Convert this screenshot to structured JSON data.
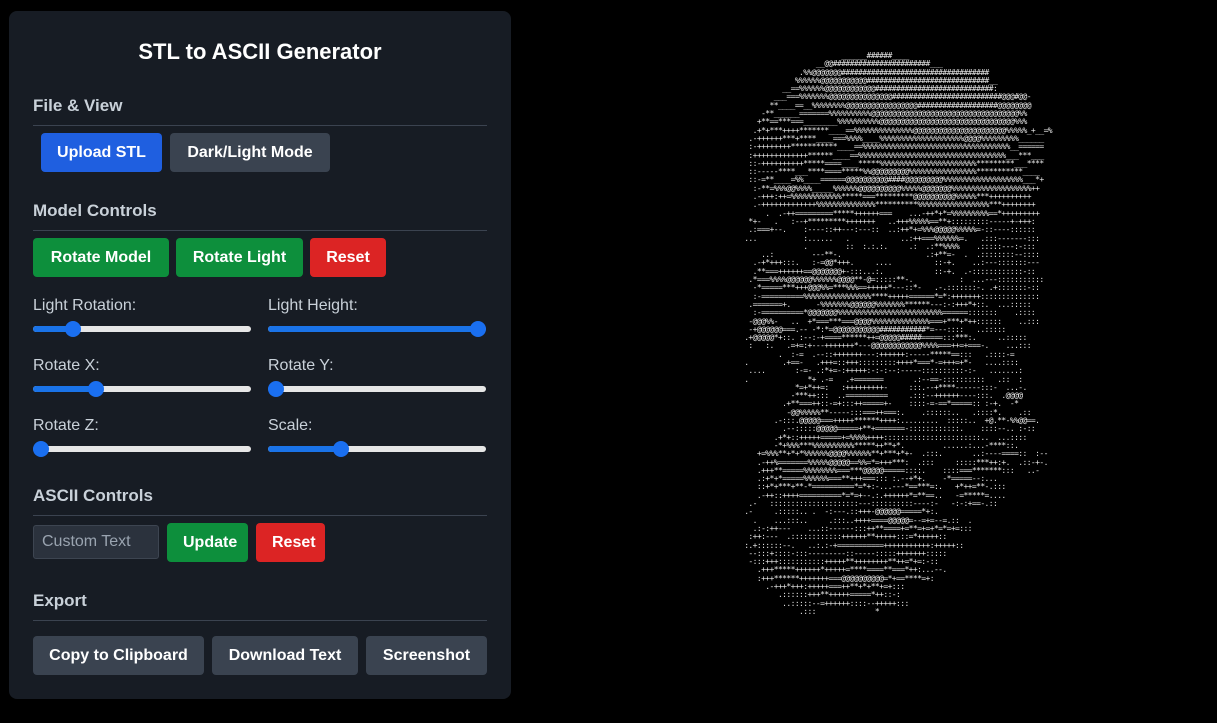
{
  "title": "STL to ASCII Generator",
  "sections": {
    "file_view": "File & View",
    "model_controls": "Model Controls",
    "ascii_controls": "ASCII Controls",
    "export": "Export"
  },
  "buttons": {
    "upload": "Upload STL",
    "theme": "Dark/Light Mode",
    "rotate_model": "Rotate Model",
    "rotate_light": "Rotate Light",
    "reset_model": "Reset",
    "update": "Update",
    "reset_ascii": "Reset",
    "copy": "Copy to Clipboard",
    "download": "Download Text",
    "screenshot": "Screenshot"
  },
  "sliders": [
    {
      "label": "Light Rotation:",
      "value": 0.16
    },
    {
      "label": "Light Height:",
      "value": 1.0
    },
    {
      "label": "Rotate X:",
      "value": 0.27
    },
    {
      "label": "Rotate Y:",
      "value": 0.0
    },
    {
      "label": "Rotate Z:",
      "value": 0.0
    },
    {
      "label": "Scale:",
      "value": 0.32
    }
  ],
  "custom_text": {
    "placeholder": "Custom Text",
    "value": ""
  },
  "colors": {
    "background": "#000000",
    "panel": "#171c24",
    "blue": "#1f5fe0",
    "green": "#0d8f3c",
    "red": "#dc2424",
    "gray": "#3a4350",
    "slider_accent": "#1a73e8"
  },
  "ascii_art": "                        ______######____\n                  __@@#######################___\n              .%%@@@@@@@###################################\n             %%%%%%@@@@@@@@@@@#############################__\n          __==%%%%%%@@@@@@@@@@@@############################:\n        ___===%%%%%%%@@@@@@@@@@@@@@@##########################@@@#@@-\n       **____==__%%%%%%%%@@@@@@@@@@@@@@@@@###################@@@@@@@@\n     -**______=======%%%%%%%%%%@@@@@@@@@@@@@@@@@@@@@@@@@@@@@@@@@@@%%\n    +**==***===________%%%%%%%%%%@@@@@@@@@@@@@@@@@@@@@@@@@@@@@@@@%%%\n   .+*+***++++*******____==%%%%%%%%%%%%%%@@@@@@@@@@@@@@@@@@@@@@%%%%%_+__=%\n  .-++++++***+****____===%%%%____%%%%%%%%%%%%%%%%%%%%@@@@%%%%%%%%%______\n  :-++++++++***********____==%%%%%%%%%%%%%%%%%%%%%%%%%%%%%%%%%%%__======\n  :+++++++++++++******____==%%%%%%%%%%%%%%%%%%%%%%%%%%%%%%%%%%%___***___\n  ::-++++++++++*****====____*****%%%%%%%%%%%%%%%%%%%%%%%*********___****\n  ::-----****___****====*****%%@@@@@@@@@%%%%%%%%%%%%%%%%***********____\n  ::-=**____=%%____======@@@@@@@@@@####@@@@@@@@@%%%%%%%%%%%%%%%%%%%___*+\n   :-**=%%%@@%%%%_____%%%%%%@@@@@@@@@@%%%%%@@@@@@@%%%%%%%%%%%%%%%%%%%++\n   .-+++:++=%%%%%%%%%%%%*****===*********@@@@@@@@@@%%%%%***++++++++++\n   .-+++++++++++++%%%%%%%%%%%%%%**********%%%%%%%%%%%%%%%%%***++++++++\n      .  .-++=========*****++++++===    ...-++*+*=%%%%%%%%%==*+++++++++\n  *+-   .   :--+*********+++++++   ..+++%%%%%==**+:::::::::-----+-+++:\n  .:===+--.    :----::++---:---::  ..:++*+=%%%@@@@@%%%%%=-::----::::::\n ...           :......   .            ..:++===%%%%%%=.   .:::-------:::\n               .         ::  :.:.:.     .:  .:**%%%%    .:::::---:-:::\n     ..:         ---**-.                    .:+**=-  .  .::::::::--::::\n   .-+*+++:::.   :-=@@*+++.     ....          ::-+.    ..:---:::::::---\n   .**===++++++==@@@@@@@+-:::...:.            ::-+.  .-::::::::::::-::\n  .*===%%%%@@@@@@%%%%%%@@@@**-@=:::::**-.           :  ...---:::::::::::\n   -*=====***+++@@@%%=***%%%==+++++*---::*-   .-.:::::::-. .+:::::::-::\n   :-==========%%%%%%%%%%%%%%%%****+++++======*=*:+++++++::::::::::::::\n  .=======+.      -%%%%%%%@@@@@@%%%%%%%******---:-:+++*+::.  ...:::::\n   :-==========*@@@@@@@%%%%%%%%%%%%%%%%%%%%%%%%%======:::::::    .::::\n  -@@@%%-   ..  +*===***===@@@@%%%%%%%%%%%%%%===+***+*++::::::    ..:::\n  -+@@@@@@===.-- -*:*=@@@@@@@@@@@###########*=---::::   ..:::::\n .+@@@@@*+::. :--:-+====******++=@@@@@#####=====:::***:.     ..:::::\n  :   :.   .=+=:+---+++++++*---@@@@@@@@@@@@%%%%===++=+===-.    ...:::\n         .  :-=  .--::+++++++---:++++++:-----*****==:::   .::::-=\n .        .+==-   .+++=::+++:::::::::++++*===*-=+++=+*-   ....::::\n  ....       :-=- .:*+=-:+++++:-:-:--:-----::::::::::-:-   .......:\n .              *+ .-=   .+=======       .:--==-::::::::::   .::  :\n             *=+*++=:   :+++++++++-     :::.--+****------:::-  ...-.\n            -***++:::  ..==========     .:::--++++++----:::.  .@@@@\n          .+**===++::-=+:::++=====+-    ::::-=-==*=====:: :-+.  -*\n           -@@%%%%%**-----:::===++===:.    .::::::..   .::::*.    .::\n        .-:::.@@@@@===+++++******++++:.........  :::::..  +@.**-%%@@==.\n          .--:::::@@@@@=====+**+=======-::::::::::::.    ::::--.. :-::\n        .+*+::+++++=====+=%%%%++++:::::::::::::::::::::::..  ...::::\n        -*+%%%***%%%%%%%%%%*****++**+*.         ......:...-****::.\n    +=%%%**+*+*%%%%%%@@@@%%%%%%**+***+*+-  .:::.       ..:----====::  :--\n    .-++%=======%%%%%@@@@@==%%=*=+++***:  .:::     :::::***++:+.  .::-+-.\n    .+++**=====%%%%%%%%===***@@@@@=====::::.    ::::===*******:::   ..-\n    .:+*+*=====%%%%%%===**+++===::: :.--+*+.    -*=====--:...\n    ::+*+***+**-*==========*=*+:-...---*==***=:.   +*++=**-.:::\n    .-++::++++==========*=*=+--.:.++++++*=**==..   -=*****=....\n  .-   :::::::::::::::::::::---::::::::::----:-   -:-:+==-.::\n .-     .:::::.. .  -:---.::+++-@@@@@@=====*+:.\n   .    ...:::..     .:::..++++====@@@@@=--=+=--=.::  .\n   .:-:++---    ...::------:::++**====+=**=+=+*=*=+=:::\n  :++:---  .::::::::::::++++++**+++++:::=*+++++::\n :.+::::::--.   ..:.:-+===========+++++++++++:+++++::\n  --:::+::::-:::---------::-----:::::+++++++:::::\n  -:::+++:::::::::::+++++**++++++++**++=*+=:-::\n    .+++*****++++++*+++++=****====**===*++:...--.\n    :+++******+++++++===@@@@@@@@@@=*+==****=+:\n      .-+++*+++:+++++===++**+*+**+=+:::\n         .::::::+++**+++++=====*++::-:\n          ..:::::--=++++++::::--+++++:::\n              .:::              *"
}
